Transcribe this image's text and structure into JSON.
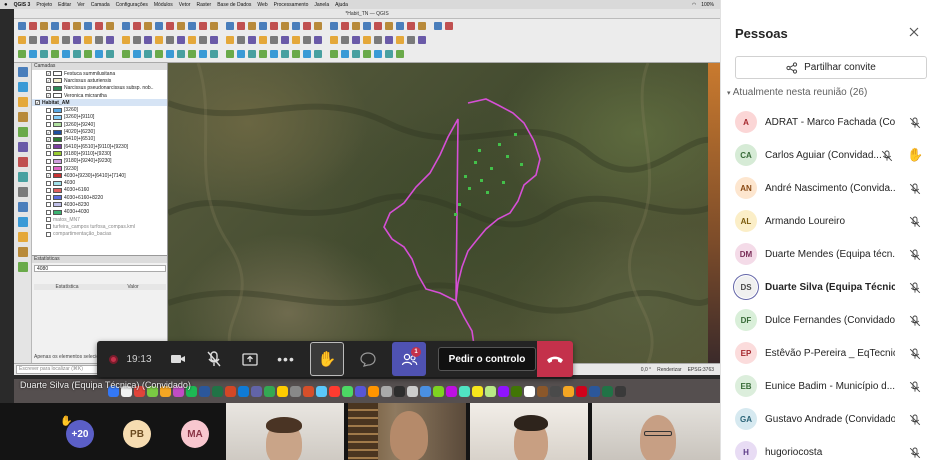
{
  "mac_menubar": {
    "app": "QGIS 3",
    "menus": [
      "Projeto",
      "Editar",
      "Ver",
      "Camada",
      "Configurações",
      "Módulos",
      "Vetor",
      "Raster",
      "Base de Dados",
      "Web",
      "Processamento",
      "Janela",
      "Ajuda"
    ],
    "battery": "100%"
  },
  "qgis": {
    "window_title": "*Habit_TN — QGIS",
    "layers_panel_title": "Camadas",
    "layers": [
      {
        "label": "Festuca summilusitana",
        "checked": true,
        "color": "#ffffff"
      },
      {
        "label": "Narcissus asturiensis",
        "checked": true,
        "color": "#f5f0d0"
      },
      {
        "label": "Narcissus pseudonarcissus subsp. nob..",
        "checked": true,
        "color": "#2e8b57"
      },
      {
        "label": "Veronica micrantha",
        "checked": true,
        "color": "#ffffff"
      },
      {
        "label": "Habitat_AM",
        "checked": true,
        "group": true
      },
      {
        "label": "[3260]",
        "checked": false,
        "color": "#5aa9e6"
      },
      {
        "label": "[3260]+[9110]",
        "checked": false,
        "color": "#87cefa"
      },
      {
        "label": "[3260]+[9240]",
        "checked": false,
        "color": "#b0e0a0"
      },
      {
        "label": "[4020]+[6230]",
        "checked": true,
        "color": "#1f4fa0"
      },
      {
        "label": "[6410]+[6510]",
        "checked": true,
        "color": "#2e7d32"
      },
      {
        "label": "[6410]+[6510]+[9110]+[9230]",
        "checked": true,
        "color": "#7b3fa0"
      },
      {
        "label": "[9180]+[9110]+[9230]",
        "checked": false,
        "color": "#9acd32"
      },
      {
        "label": "[9180]+[9240]+[9230]",
        "checked": false,
        "color": "#cfa0e0"
      },
      {
        "label": "[9230]",
        "checked": false,
        "color": "#e066c8"
      },
      {
        "label": "4030+[9230]+[6410]+[7140]",
        "checked": true,
        "color": "#c83232"
      },
      {
        "label": "4030",
        "checked": false,
        "color": "#a0e0e8"
      },
      {
        "label": "4030+6160",
        "checked": false,
        "color": "#e06060"
      },
      {
        "label": "4030+6160+8220",
        "checked": false,
        "color": "#5a6ee0"
      },
      {
        "label": "4030+8230",
        "checked": false,
        "color": "#c0c0e8"
      },
      {
        "label": "4030+4030",
        "checked": false,
        "color": "#3cb371"
      },
      {
        "label": "matos_MN7",
        "checked": false,
        "dim": true
      },
      {
        "label": "turfeira_campos turfosa_compas.kml",
        "checked": false,
        "dim": true
      },
      {
        "label": "compartimentação_bacias",
        "checked": false,
        "dim": true
      }
    ],
    "stats_title": "Estatísticas",
    "stats_field": "4080",
    "stats_columns": [
      "Estatística",
      "Valor"
    ],
    "stats_footer": "Apenas os elementos selecionados",
    "locator_placeholder": "Escrever para localizar (⌘K)",
    "status_scale": "0,0 °",
    "status_render": "Renderizar",
    "status_crs": "EPSG:3763"
  },
  "presenter_label": "Duarte Silva (Equipa Técnica) (Convidado)",
  "meeting_bar": {
    "timer": "19:13",
    "request_control": "Pedir o controlo",
    "people_badge": "1"
  },
  "video_strip": {
    "overflow_count": "+20",
    "avatars": [
      "PB",
      "MA"
    ],
    "avatar_colors": [
      "#f6dcb1",
      "#f8c7cf"
    ]
  },
  "people_panel": {
    "title": "Pessoas",
    "invite_label": "Partilhar convite",
    "section_header": "Atualmente nesta reunião (26)",
    "participants": [
      {
        "initials": "A",
        "name": "ADRAT - Marco Fachada (Co...",
        "bg": "#fbd6d6",
        "fg": "#a4262c"
      },
      {
        "initials": "CA",
        "name": "Carlos Aguiar (Convidad...",
        "bg": "#d6ebd6",
        "fg": "#386b38",
        "hand": true
      },
      {
        "initials": "AN",
        "name": "André Nascimento (Convida...",
        "bg": "#fde6cf",
        "fg": "#8a4a14"
      },
      {
        "initials": "AL",
        "name": "Armando Loureiro",
        "bg": "#fbeec7",
        "fg": "#7a5a0c"
      },
      {
        "initials": "DM",
        "name": "Duarte Mendes (Equipa técn...",
        "bg": "#f4dbe8",
        "fg": "#7a2e58"
      },
      {
        "initials": "DS",
        "name": "Duarte Silva (Equipa Técnica) (...",
        "bg": "#f0f0f0",
        "fg": "#4a4a4a",
        "bold": true,
        "speaking": true
      },
      {
        "initials": "DF",
        "name": "Dulce Fernandes (Convidado)",
        "bg": "#d9efd9",
        "fg": "#386b38"
      },
      {
        "initials": "EP",
        "name": "Estêvão P-Pereira _ EqTecnic...",
        "bg": "#fbdcdc",
        "fg": "#a4262c"
      },
      {
        "initials": "EB",
        "name": "Eunice Badim - Município d...",
        "bg": "#dceedc",
        "fg": "#386b38"
      },
      {
        "initials": "GA",
        "name": "Gustavo Andrade (Convidado)",
        "bg": "#d6e9f0",
        "fg": "#2a6478"
      },
      {
        "initials": "H",
        "name": "hugoriocosta",
        "bg": "#e8dcf4",
        "fg": "#5b3a86"
      }
    ]
  },
  "colors": {
    "teams_purple": "#5b5fc7",
    "hangup_red": "#c4314b",
    "boundary_magenta": "#d64fd6",
    "habitat_green": "#43c04a"
  }
}
